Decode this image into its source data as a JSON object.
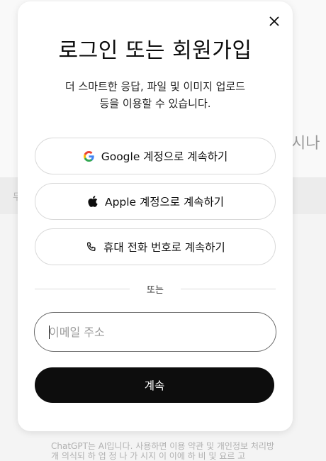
{
  "background": {
    "header_fragment": "·시나",
    "band_fragment": "무",
    "footer_line1": "ChatGPT는 AI입니다. 사용하면 이용 약관 및 개인정보 처리방",
    "footer_line2": "개 의식되 하 업 정 나 가 시지 이 이에 하 비 및 요르 고"
  },
  "modal": {
    "close_icon": "close-icon",
    "title": "로그인 또는 회원가입",
    "subtitle_line1": "더 스마트한 응답, 파일 및 이미지 업로드",
    "subtitle_line2": "등을 이용할 수 있습니다.",
    "providers": [
      {
        "label": "Google 계정으로 계속하기",
        "icon": "google-icon"
      },
      {
        "label": "Apple 계정으로 계속하기",
        "icon": "apple-icon"
      },
      {
        "label": "휴대 전화 번호로 계속하기",
        "icon": "phone-icon"
      }
    ],
    "divider_text": "또는",
    "email": {
      "value": "",
      "placeholder": "이메일 주소"
    },
    "continue_label": "계속"
  },
  "colors": {
    "primary_button": "#0d0d0d",
    "primary_button_text": "#ffffff",
    "border": "#d9d9d9",
    "input_border": "#6b6b6b",
    "background": "#f4f4f4"
  }
}
